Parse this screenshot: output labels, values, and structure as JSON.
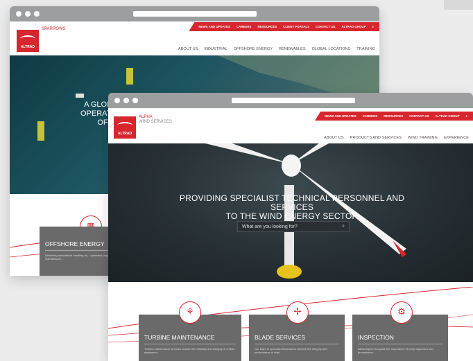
{
  "back": {
    "subbrand": "SPARROWS",
    "logo_word": "ALTRAD",
    "top_nav": [
      "NEWS AND UPDATES",
      "CAREERS",
      "RESOURCES",
      "CLIENT PORTALS",
      "CONTACT US",
      "ALTRAD GROUP"
    ],
    "main_nav": [
      "ABOUT US",
      "INDUSTRIAL",
      "OFFSHORE ENERGY",
      "RENEWABLES",
      "GLOBAL LOCATIONS",
      "TRAINING"
    ],
    "hero_lines": [
      "A GLOBAL",
      "OPERATION",
      "OF"
    ],
    "card": {
      "title": "OFFSHORE ENERGY",
      "body": "Delivering mechanical handling eq... operation, inspection, maintenance..."
    }
  },
  "front": {
    "subbrand_line1": "ALPHA",
    "subbrand_line2": "WIND SERVICES",
    "logo_word": "ALTRAD",
    "top_nav": [
      "NEWS AND UPDATES",
      "CAREERS",
      "RESOURCES",
      "CONTACT US",
      "ALTRAD GROUP"
    ],
    "main_nav": [
      "ABOUT US",
      "PRODUCTS AND SERVICES",
      "WIND TRAINING",
      "EXPERIENCE"
    ],
    "hero_line1": "PROVIDING SPECIALIST TECHNICAL PERSONNEL AND SERVICES",
    "hero_line2": "TO THE WIND ENERGY SECTOR",
    "search_placeholder": "What are you looking for?",
    "cards": [
      {
        "title": "TURBINE MAINTENANCE",
        "body": "Turbine maintenance services ensure the reliability and integrity of critical equipment."
      },
      {
        "title": "BLADE SERVICES",
        "body": "Our team of specialist technicians improve the integrity and performance of wind"
      },
      {
        "title": "INSPECTION",
        "body": "Altrad Alpha recognise the importance of early inspection and preventative"
      }
    ]
  }
}
